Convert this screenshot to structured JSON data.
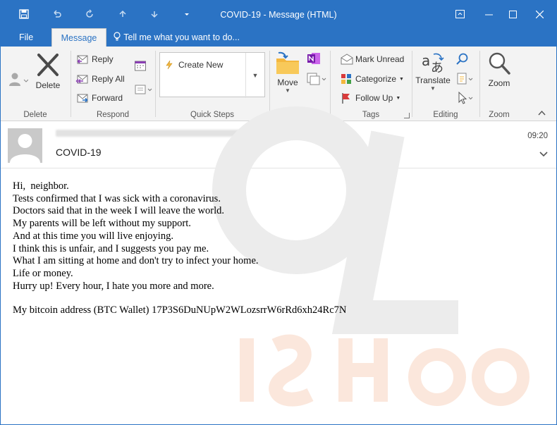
{
  "window": {
    "title": "COVID-19  -  Message (HTML)"
  },
  "tabs": {
    "file": "File",
    "message": "Message",
    "tell_me": "Tell me what you want to do..."
  },
  "ribbon": {
    "delete_group": {
      "delete": "Delete",
      "label": "Delete"
    },
    "respond_group": {
      "reply": "Reply",
      "reply_all": "Reply All",
      "forward": "Forward",
      "label": "Respond"
    },
    "quick_steps_group": {
      "create_new": "Create New",
      "label": "Quick Steps"
    },
    "move_group": {
      "move": "Move",
      "label": "Move"
    },
    "tags_group": {
      "mark_unread": "Mark Unread",
      "categorize": "Categorize",
      "follow_up": "Follow Up",
      "label": "Tags"
    },
    "editing_group": {
      "translate": "Translate",
      "label": "Editing"
    },
    "zoom_group": {
      "zoom": "Zoom",
      "label": "Zoom"
    }
  },
  "message": {
    "time": "09:20",
    "subject": "COVID-19",
    "body_lines": [
      "Hi,  neighbor.",
      "Tests confirmed that I was sick with a coronavirus.",
      "Doctors said that in the week I will leave the world.",
      "My parents will be left without my support.",
      "And at this time you will live enjoying.",
      "I think this is unfair, and I suggests you pay me.",
      "What I am sitting at home and don't try to infect your home.",
      "Life or money.",
      "Hurry up! Every hour, I hate you more and more."
    ],
    "bitcoin_line": "My bitcoin address (BTC Wallet) 17P3S6DuNUpW2WLozsrrW6rRd6xh24Rc7N"
  },
  "colors": {
    "titlebar": "#2b73c4",
    "ribbon": "#f3f3f3"
  }
}
